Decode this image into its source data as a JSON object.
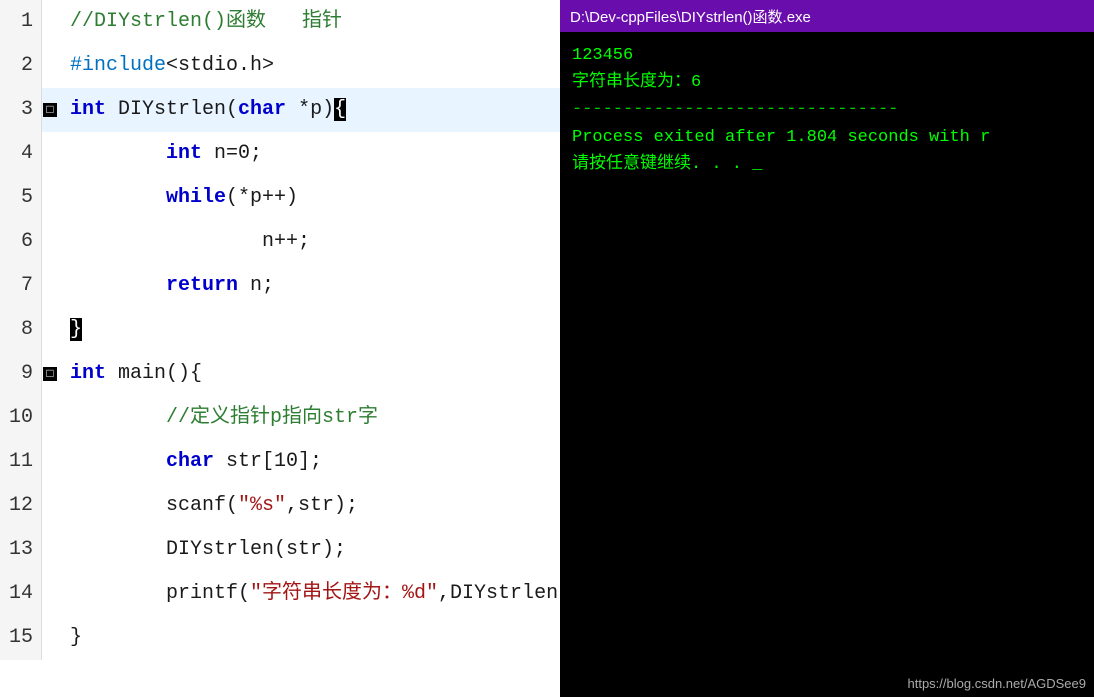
{
  "terminal": {
    "title": "D:\\Dev-cppFiles\\DIYstrlen()函数.exe",
    "lines": [
      {
        "type": "output",
        "text": "123456"
      },
      {
        "type": "output",
        "text": "字符串长度为：6"
      },
      {
        "type": "separator",
        "text": "--------------------------------"
      },
      {
        "type": "output",
        "text": "Process exited after 1.804 seconds with r"
      },
      {
        "type": "output",
        "text": "请按任意键继续. . . _"
      }
    ]
  },
  "editor": {
    "lines": [
      {
        "num": "1",
        "fold": "",
        "content": "//DIYstrlen()函数   指针",
        "type": "comment"
      },
      {
        "num": "2",
        "fold": "",
        "content": "#include<stdio.h>",
        "type": "include"
      },
      {
        "num": "3",
        "fold": "□",
        "content": "int DIYstrlen(char *p){",
        "type": "funcdef",
        "highlight": true
      },
      {
        "num": "4",
        "fold": "",
        "content": "        int n=0;",
        "type": "normal"
      },
      {
        "num": "5",
        "fold": "",
        "content": "        while(*p++)",
        "type": "normal"
      },
      {
        "num": "6",
        "fold": "",
        "content": "                n++;",
        "type": "normal"
      },
      {
        "num": "7",
        "fold": "",
        "content": "        return n;",
        "type": "normal"
      },
      {
        "num": "8",
        "fold": "",
        "content": "}",
        "type": "normal"
      },
      {
        "num": "9",
        "fold": "□",
        "content": "int main(){",
        "type": "funcmain"
      },
      {
        "num": "10",
        "fold": "",
        "content": "        //定义指针p指向str字",
        "type": "comment"
      },
      {
        "num": "11",
        "fold": "",
        "content": "        char str[10];",
        "type": "normal"
      },
      {
        "num": "12",
        "fold": "",
        "content": "        scanf(\"%s\",str);",
        "type": "normal"
      },
      {
        "num": "13",
        "fold": "",
        "content": "        DIYstrlen(str);",
        "type": "normal"
      },
      {
        "num": "14",
        "fold": "",
        "content": "        printf(\"字符串长度为：%d\",DIYstrlen(str));",
        "type": "normal"
      },
      {
        "num": "15",
        "fold": "",
        "content": "}",
        "type": "normal"
      }
    ]
  },
  "watermark": "https://blog.csdn.net/AGDSee9"
}
